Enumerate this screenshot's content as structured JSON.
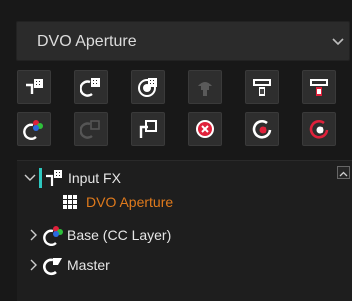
{
  "dropdown": {
    "selected": "DVO Aperture"
  },
  "toolbar": {
    "row1": [
      {
        "name": "add-serial-node-icon"
      },
      {
        "name": "add-parallel-node-icon"
      },
      {
        "name": "add-layer-node-icon"
      },
      {
        "name": "disabled-node-icon"
      },
      {
        "name": "splitter-node-icon"
      },
      {
        "name": "combiner-node-icon"
      }
    ],
    "row2": [
      {
        "name": "add-color-node-icon"
      },
      {
        "name": "disabled-parallel-icon"
      },
      {
        "name": "add-outside-node-icon"
      },
      {
        "name": "delete-node-icon"
      },
      {
        "name": "reset-node-icon"
      },
      {
        "name": "reset-node-red-icon"
      }
    ]
  },
  "tree": {
    "items": [
      {
        "label": "Input FX",
        "expanded": true
      },
      {
        "label": "DVO Aperture",
        "selected": true
      },
      {
        "label": "Base (CC Layer)",
        "expanded": false
      },
      {
        "label": "Master",
        "expanded": false
      }
    ]
  },
  "colors": {
    "accent_orange": "#e07a1c",
    "delete_red": "#e0213b"
  }
}
